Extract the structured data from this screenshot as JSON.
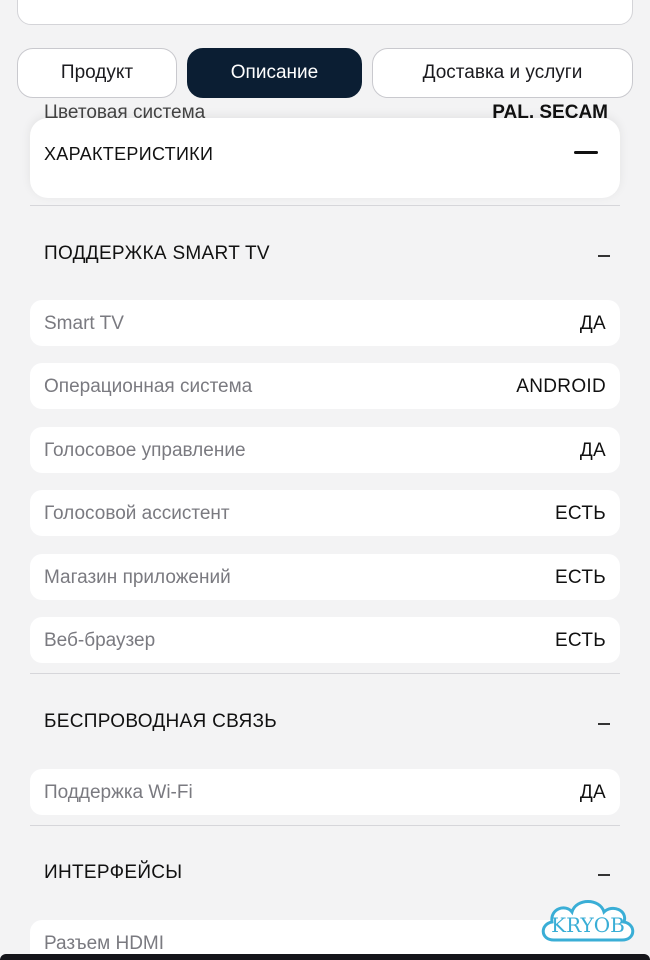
{
  "tabs": [
    {
      "label": "Продукт"
    },
    {
      "label": "Описание"
    },
    {
      "label": "Доставка и услуги"
    }
  ],
  "ghost_row": {
    "label": "Цветовая система",
    "value": "PAL, SECAM"
  },
  "sticky_header": {
    "title": "ХАРАКТЕРИСТИКИ"
  },
  "sections": [
    {
      "title": "ПОДДЕРЖКА SMART TV",
      "rows": [
        {
          "label": "Smart TV",
          "value": "ДА"
        },
        {
          "label": "Операционная система",
          "value": "ANDROID"
        },
        {
          "label": "Голосовое управление",
          "value": "ДА"
        },
        {
          "label": "Голосовой ассистент",
          "value": "ЕСТЬ"
        },
        {
          "label": "Магазин приложений",
          "value": "ЕСТЬ"
        },
        {
          "label": "Веб-браузер",
          "value": "ЕСТЬ"
        }
      ]
    },
    {
      "title": "БЕСПРОВОДНАЯ СВЯЗЬ",
      "rows": [
        {
          "label": "Поддержка Wi-Fi",
          "value": "ДА"
        }
      ]
    },
    {
      "title": "ИНТЕРФЕЙСЫ",
      "rows": [
        {
          "label": "Разъем HDMI",
          "value": ""
        }
      ]
    }
  ],
  "watermark": {
    "text": "KRYOB"
  },
  "colors": {
    "accent": "#0b1e33",
    "background": "#f3f3f4",
    "watermark": "#3aaed6"
  }
}
